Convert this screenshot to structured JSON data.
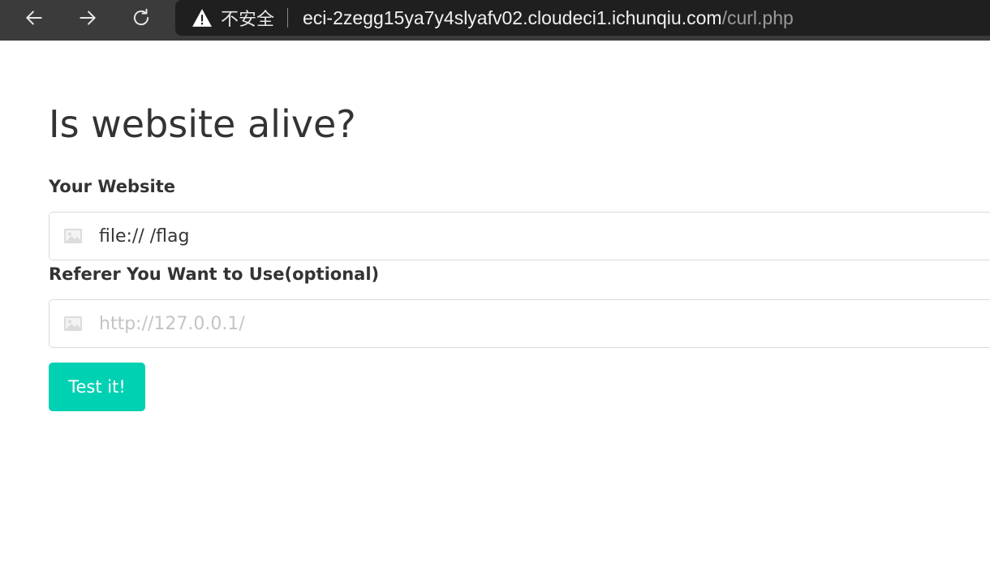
{
  "browser": {
    "security_label": "不安全",
    "url_host": "eci-2zegg15ya7y4slyafv02.cloudeci1.ichunqiu.com",
    "url_path": "/curl.php",
    "icons": [
      "back-arrow-icon",
      "forward-arrow-icon",
      "reload-icon",
      "warning-icon"
    ]
  },
  "page": {
    "title": "Is website alive?",
    "website_field": {
      "label": "Your Website",
      "value": "file:// /flag",
      "icon": "image-icon"
    },
    "referer_field": {
      "label": "Referer You Want to Use(optional)",
      "value": "",
      "placeholder": "http://127.0.0.1/",
      "icon": "image-icon"
    },
    "submit_label": "Test it!"
  },
  "colors": {
    "browser_bar": "#3b3b3b",
    "address_bar": "#1f1f1f",
    "primary_button": "#00d1b2",
    "text": "#333333"
  }
}
